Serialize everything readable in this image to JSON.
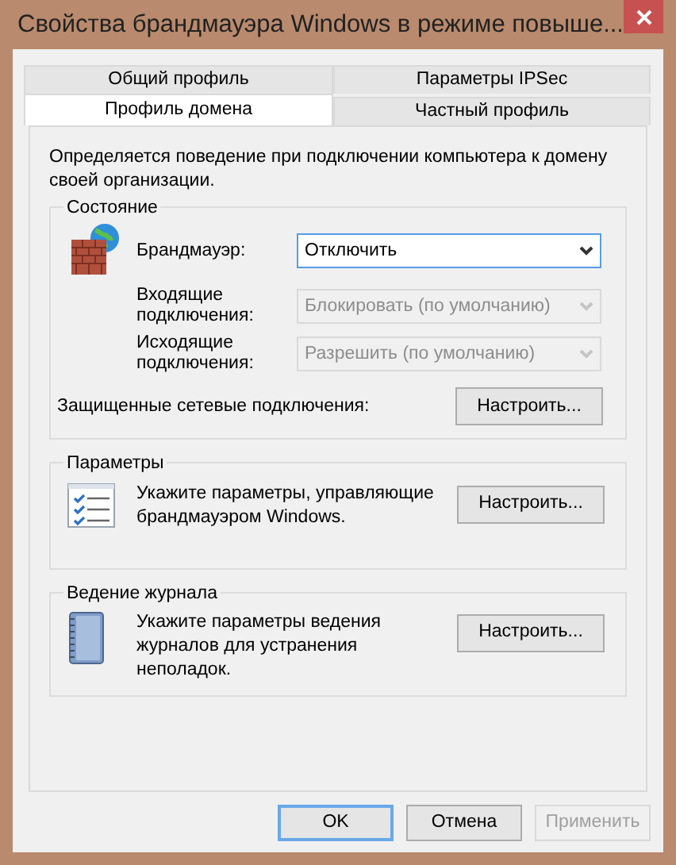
{
  "window": {
    "title": "Свойства брандмауэра Windows в режиме повыше..."
  },
  "tab_rows": [
    [
      {
        "label": "Общий профиль",
        "selected": false
      },
      {
        "label": "Параметры IPSec",
        "selected": false
      }
    ],
    [
      {
        "label": "Профиль домена",
        "selected": true
      },
      {
        "label": "Частный профиль",
        "selected": false
      }
    ]
  ],
  "description": "Определяется поведение при подключении компьютера к домену своей организации.",
  "state_group": {
    "title": "Состояние",
    "fields": [
      {
        "label": "Брандмауэр:",
        "value": "Отключить",
        "disabled": false,
        "focused": true
      },
      {
        "label": "Входящие подключения:",
        "value": "Блокировать (по умолчанию)",
        "disabled": true,
        "focused": false
      },
      {
        "label": "Исходящие подключения:",
        "value": "Разрешить (по умолчанию)",
        "disabled": true,
        "focused": false
      }
    ],
    "protected_label": "Защищенные сетевые подключения:",
    "button": "Настроить..."
  },
  "groups": [
    {
      "title": "Параметры",
      "kind": "checklist",
      "text": "Укажите параметры, управляющие брандмауэром Windows.",
      "button": "Настроить..."
    },
    {
      "title": "Ведение журнала",
      "kind": "notebook",
      "text": "Укажите параметры ведения журналов для устранения неполадок.",
      "button": "Настроить..."
    }
  ],
  "buttons": [
    {
      "label": "OK",
      "default": true,
      "disabled": false
    },
    {
      "label": "Отмена",
      "default": false,
      "disabled": false
    },
    {
      "label": "Применить",
      "default": false,
      "disabled": true
    }
  ]
}
